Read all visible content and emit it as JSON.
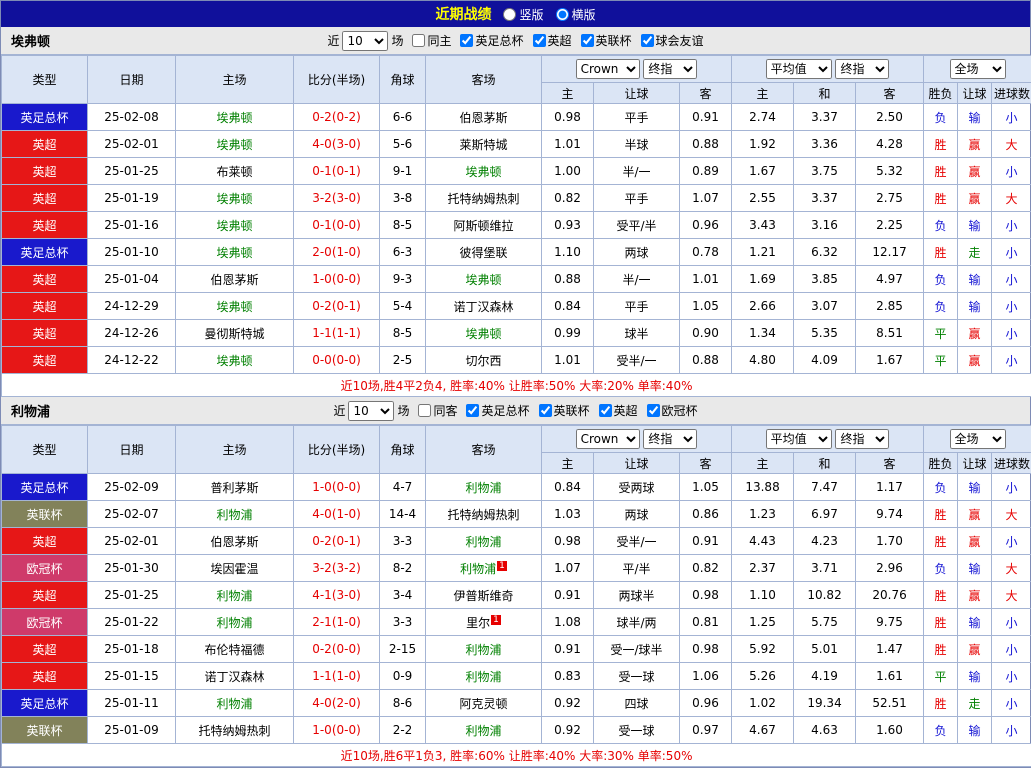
{
  "topbar": {
    "title": "近期战绩",
    "radio_vertical": "竖版",
    "vertical_checked": false,
    "radio_horizontal": "横版",
    "horizontal_checked": true
  },
  "colors": {
    "league": {
      "英足总杯": "#1919cc",
      "英超": "#e61717",
      "英联杯": "#82825a",
      "欧冠杯": "#cf3a6a"
    },
    "result_win": "#e60000",
    "result_draw": "#008000",
    "result_loss": "#1414d4",
    "team_highlight": "#008000",
    "score": "#e60000"
  },
  "table_header": {
    "col_type": "类型",
    "col_date": "日期",
    "col_home": "主场",
    "col_score": "比分(半场)",
    "col_corner": "角球",
    "col_away": "客场",
    "bookmaker_select": "Crown",
    "final_select": "终指",
    "average_select": "平均值",
    "final_select2": "终指",
    "full_select": "全场",
    "sub_home": "主",
    "sub_handicap": "让球",
    "sub_away": "客",
    "sub_avg_home": "主",
    "sub_avg_draw": "和",
    "sub_avg_away": "客",
    "sub_result": "胜负",
    "sub_handicap_result": "让球",
    "sub_goals": "进球数"
  },
  "sections": [
    {
      "team": "埃弗顿",
      "filter": {
        "prefix": "近",
        "count": "10",
        "suffix": "场",
        "same_label": "同主",
        "same_checked": false,
        "leagues": [
          {
            "label": "英足总杯",
            "checked": true
          },
          {
            "label": "英超",
            "checked": true
          },
          {
            "label": "英联杯",
            "checked": true
          },
          {
            "label": "球会友谊",
            "checked": true
          }
        ]
      },
      "rows": [
        {
          "league": "英足总杯",
          "date": "25-02-08",
          "home": "埃弗顿",
          "home_team": true,
          "score": "0-2(0-2)",
          "corner": "6-6",
          "away": "伯恩茅斯",
          "odds": [
            "0.98",
            "平手",
            "0.91",
            "2.74",
            "3.37",
            "2.50"
          ],
          "results": [
            "负",
            "输",
            "小"
          ]
        },
        {
          "league": "英超",
          "date": "25-02-01",
          "home": "埃弗顿",
          "home_team": true,
          "score": "4-0(3-0)",
          "corner": "5-6",
          "away": "莱斯特城",
          "odds": [
            "1.01",
            "半球",
            "0.88",
            "1.92",
            "3.36",
            "4.28"
          ],
          "results": [
            "胜",
            "赢",
            "大"
          ]
        },
        {
          "league": "英超",
          "date": "25-01-25",
          "home": "布莱顿",
          "score": "0-1(0-1)",
          "corner": "9-1",
          "away": "埃弗顿",
          "away_team": true,
          "odds": [
            "1.00",
            "半/一",
            "0.89",
            "1.67",
            "3.75",
            "5.32"
          ],
          "results": [
            "胜",
            "赢",
            "小"
          ]
        },
        {
          "league": "英超",
          "date": "25-01-19",
          "home": "埃弗顿",
          "home_team": true,
          "score": "3-2(3-0)",
          "corner": "3-8",
          "away": "托特纳姆热刺",
          "odds": [
            "0.82",
            "平手",
            "1.07",
            "2.55",
            "3.37",
            "2.75"
          ],
          "results": [
            "胜",
            "赢",
            "大"
          ]
        },
        {
          "league": "英超",
          "date": "25-01-16",
          "home": "埃弗顿",
          "home_team": true,
          "score": "0-1(0-0)",
          "corner": "8-5",
          "away": "阿斯顿维拉",
          "odds": [
            "0.93",
            "受平/半",
            "0.96",
            "3.43",
            "3.16",
            "2.25"
          ],
          "results": [
            "负",
            "输",
            "小"
          ]
        },
        {
          "league": "英足总杯",
          "date": "25-01-10",
          "home": "埃弗顿",
          "home_team": true,
          "score": "2-0(1-0)",
          "corner": "6-3",
          "away": "彼得堡联",
          "odds": [
            "1.10",
            "两球",
            "0.78",
            "1.21",
            "6.32",
            "12.17"
          ],
          "results": [
            "胜",
            "走",
            "小"
          ]
        },
        {
          "league": "英超",
          "date": "25-01-04",
          "home": "伯恩茅斯",
          "score": "1-0(0-0)",
          "corner": "9-3",
          "away": "埃弗顿",
          "away_team": true,
          "odds": [
            "0.88",
            "半/一",
            "1.01",
            "1.69",
            "3.85",
            "4.97"
          ],
          "results": [
            "负",
            "输",
            "小"
          ]
        },
        {
          "league": "英超",
          "date": "24-12-29",
          "home": "埃弗顿",
          "home_team": true,
          "score": "0-2(0-1)",
          "corner": "5-4",
          "away": "诺丁汉森林",
          "odds": [
            "0.84",
            "平手",
            "1.05",
            "2.66",
            "3.07",
            "2.85"
          ],
          "results": [
            "负",
            "输",
            "小"
          ]
        },
        {
          "league": "英超",
          "date": "24-12-26",
          "home": "曼彻斯特城",
          "score": "1-1(1-1)",
          "corner": "8-5",
          "away": "埃弗顿",
          "away_team": true,
          "odds": [
            "0.99",
            "球半",
            "0.90",
            "1.34",
            "5.35",
            "8.51"
          ],
          "results": [
            "平",
            "赢",
            "小"
          ]
        },
        {
          "league": "英超",
          "date": "24-12-22",
          "home": "埃弗顿",
          "home_team": true,
          "score": "0-0(0-0)",
          "corner": "2-5",
          "away": "切尔西",
          "odds": [
            "1.01",
            "受半/一",
            "0.88",
            "4.80",
            "4.09",
            "1.67"
          ],
          "results": [
            "平",
            "赢",
            "小"
          ]
        }
      ],
      "summary": "近10场,胜4平2负4, 胜率:40% 让胜率:50% 大率:20% 单率:40%"
    },
    {
      "team": "利物浦",
      "filter": {
        "prefix": "近",
        "count": "10",
        "suffix": "场",
        "same_label": "同客",
        "same_checked": false,
        "leagues": [
          {
            "label": "英足总杯",
            "checked": true
          },
          {
            "label": "英联杯",
            "checked": true
          },
          {
            "label": "英超",
            "checked": true
          },
          {
            "label": "欧冠杯",
            "checked": true
          }
        ]
      },
      "rows": [
        {
          "league": "英足总杯",
          "date": "25-02-09",
          "home": "普利茅斯",
          "score": "1-0(0-0)",
          "corner": "4-7",
          "away": "利物浦",
          "away_team": true,
          "odds": [
            "0.84",
            "受两球",
            "1.05",
            "13.88",
            "7.47",
            "1.17"
          ],
          "results": [
            "负",
            "输",
            "小"
          ]
        },
        {
          "league": "英联杯",
          "date": "25-02-07",
          "home": "利物浦",
          "home_team": true,
          "score": "4-0(1-0)",
          "corner": "14-4",
          "away": "托特纳姆热刺",
          "odds": [
            "1.03",
            "两球",
            "0.86",
            "1.23",
            "6.97",
            "9.74"
          ],
          "results": [
            "胜",
            "赢",
            "大"
          ]
        },
        {
          "league": "英超",
          "date": "25-02-01",
          "home": "伯恩茅斯",
          "score": "0-2(0-1)",
          "corner": "3-3",
          "away": "利物浦",
          "away_team": true,
          "odds": [
            "0.98",
            "受半/一",
            "0.91",
            "4.43",
            "4.23",
            "1.70"
          ],
          "results": [
            "胜",
            "赢",
            "小"
          ]
        },
        {
          "league": "欧冠杯",
          "date": "25-01-30",
          "home": "埃因霍温",
          "score": "3-2(3-2)",
          "corner": "8-2",
          "away": "利物浦",
          "away_team": true,
          "away_sup": "1",
          "odds": [
            "1.07",
            "平/半",
            "0.82",
            "2.37",
            "3.71",
            "2.96"
          ],
          "results": [
            "负",
            "输",
            "大"
          ]
        },
        {
          "league": "英超",
          "date": "25-01-25",
          "home": "利物浦",
          "home_team": true,
          "score": "4-1(3-0)",
          "corner": "3-4",
          "away": "伊普斯维奇",
          "odds": [
            "0.91",
            "两球半",
            "0.98",
            "1.10",
            "10.82",
            "20.76"
          ],
          "results": [
            "胜",
            "赢",
            "大"
          ]
        },
        {
          "league": "欧冠杯",
          "date": "25-01-22",
          "home": "利物浦",
          "home_team": true,
          "score": "2-1(1-0)",
          "corner": "3-3",
          "away": "里尔",
          "away_sup": "1",
          "odds": [
            "1.08",
            "球半/两",
            "0.81",
            "1.25",
            "5.75",
            "9.75"
          ],
          "results": [
            "胜",
            "输",
            "小"
          ]
        },
        {
          "league": "英超",
          "date": "25-01-18",
          "home": "布伦特福德",
          "score": "0-2(0-0)",
          "corner": "2-15",
          "away": "利物浦",
          "away_team": true,
          "odds": [
            "0.91",
            "受一/球半",
            "0.98",
            "5.92",
            "5.01",
            "1.47"
          ],
          "results": [
            "胜",
            "赢",
            "小"
          ]
        },
        {
          "league": "英超",
          "date": "25-01-15",
          "home": "诺丁汉森林",
          "score": "1-1(1-0)",
          "corner": "0-9",
          "away": "利物浦",
          "away_team": true,
          "odds": [
            "0.83",
            "受一球",
            "1.06",
            "5.26",
            "4.19",
            "1.61"
          ],
          "results": [
            "平",
            "输",
            "小"
          ]
        },
        {
          "league": "英足总杯",
          "date": "25-01-11",
          "home": "利物浦",
          "home_team": true,
          "score": "4-0(2-0)",
          "corner": "8-6",
          "away": "阿克灵顿",
          "odds": [
            "0.92",
            "四球",
            "0.96",
            "1.02",
            "19.34",
            "52.51"
          ],
          "results": [
            "胜",
            "走",
            "小"
          ]
        },
        {
          "league": "英联杯",
          "date": "25-01-09",
          "home": "托特纳姆热刺",
          "score": "1-0(0-0)",
          "corner": "2-2",
          "away": "利物浦",
          "away_team": true,
          "odds": [
            "0.92",
            "受一球",
            "0.97",
            "4.67",
            "4.63",
            "1.60"
          ],
          "results": [
            "负",
            "输",
            "小"
          ]
        }
      ],
      "summary": "近10场,胜6平1负3, 胜率:60% 让胜率:40% 大率:30% 单率:50%"
    }
  ]
}
